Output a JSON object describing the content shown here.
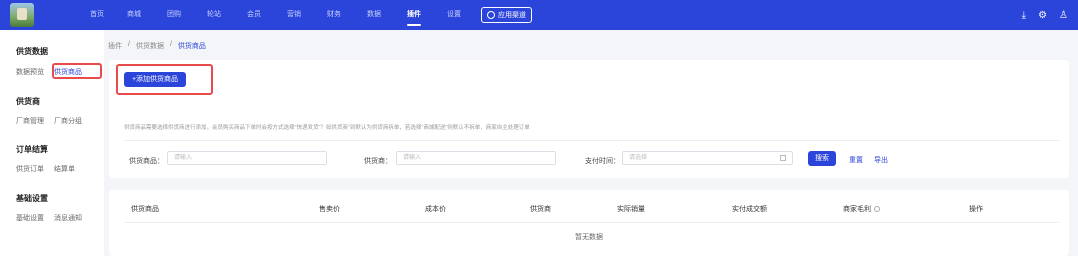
{
  "topnav": {
    "items": [
      "首页",
      "商城",
      "团购",
      "轮站",
      "会员",
      "营销",
      "财务",
      "数据",
      "插件",
      "设置"
    ],
    "active_index": 8,
    "app_button": "应用渠道",
    "accent": "#2b44d9"
  },
  "sidebar": {
    "groups": [
      {
        "title": "供货数据",
        "items": [
          "数据预览",
          "供货商品"
        ]
      },
      {
        "title": "供货商",
        "items": [
          "厂商管理",
          "厂商分组"
        ]
      },
      {
        "title": "订单结算",
        "items": [
          "供货订单",
          "结算单"
        ]
      },
      {
        "title": "基础设置",
        "items": [
          "基础设置",
          "消息通知"
        ]
      }
    ],
    "active": "供货商品"
  },
  "breadcrumb": [
    "插件",
    "供货数据",
    "供货商品"
  ],
  "toolbar": {
    "add_label": "+添加供货商品",
    "tip": "供货商品需要选择供货商进行添加，会员购买商品下单时会按方式选择\"快递发货\"？如供货商\"到默认为供货商拆单，若选择\"商城配送\"则默认不拆单，商家自主处理订单"
  },
  "filters": {
    "product_label": "供货商品：",
    "product_placeholder": "请输入",
    "supplier_label": "供货商：",
    "supplier_placeholder": "请输入",
    "time_label": "支付时间：",
    "time_placeholder": "请选择",
    "search_label": "搜索",
    "reset_label": "重置",
    "export_label": "导出"
  },
  "table": {
    "columns": [
      "供货商品",
      "售卖价",
      "成本价",
      "供货商",
      "实际销量",
      "实付成交额",
      "商家毛利",
      "操作"
    ],
    "empty_text": "暂无数据"
  }
}
